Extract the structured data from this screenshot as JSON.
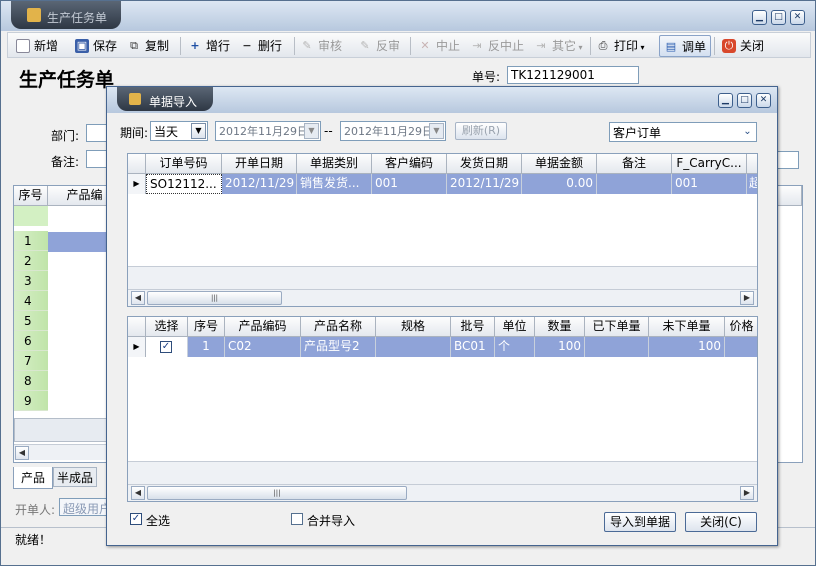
{
  "window": {
    "title": "生产任务单"
  },
  "toolbar": {
    "new": "新增",
    "save": "保存",
    "copy": "复制",
    "add_row": "增行",
    "del_row": "删行",
    "audit": "审核",
    "unaudit": "反审",
    "stop": "中止",
    "unstop": "反中止",
    "other": "其它",
    "print": "打印",
    "import": "调单",
    "close": "关闭"
  },
  "form": {
    "title": "生产任务单",
    "doc_no_label": "单号:",
    "doc_no_value": "TK121129001",
    "dept_label": "部门:",
    "remark_label": "备注:",
    "col_seq": "序号",
    "col_product": "产品编",
    "row_numbers": [
      "1",
      "2",
      "3",
      "4",
      "5",
      "6",
      "7",
      "8",
      "9"
    ],
    "tab_product": "产品",
    "tab_semi": "半成品",
    "creator_label": "开单人:",
    "creator_value": "超级用户",
    "status": "就绪！"
  },
  "dialog": {
    "title": "单据导入",
    "period_label": "期间:",
    "period_value": "当天",
    "date_from": "2012年11月29日",
    "date_sep": "--",
    "date_to": "2012年11月29日",
    "refresh": "刷新(R)",
    "type_value": "客户订单",
    "top_headers": [
      "订单号码",
      "开单日期",
      "单据类别",
      "客户编码",
      "发货日期",
      "单据金额",
      "备注",
      "F_CarryC..."
    ],
    "top_row": [
      "SO12112...",
      "2012/11/29",
      "销售发货...",
      "001",
      "2012/11/29",
      "0.00",
      "",
      "001",
      "超"
    ],
    "bottom_headers": [
      "选择",
      "序号",
      "产品编码",
      "产品名称",
      "规格",
      "批号",
      "单位",
      "数量",
      "已下单量",
      "未下单量",
      "价格"
    ],
    "bottom_row": [
      "",
      "1",
      "C02",
      "产品型号2",
      "",
      "BC01",
      "个",
      "100",
      "",
      "100",
      ""
    ],
    "select_all": "全选",
    "merge_import": "合并导入",
    "import_btn": "导入到单据",
    "close_btn": "关闭(C)"
  }
}
